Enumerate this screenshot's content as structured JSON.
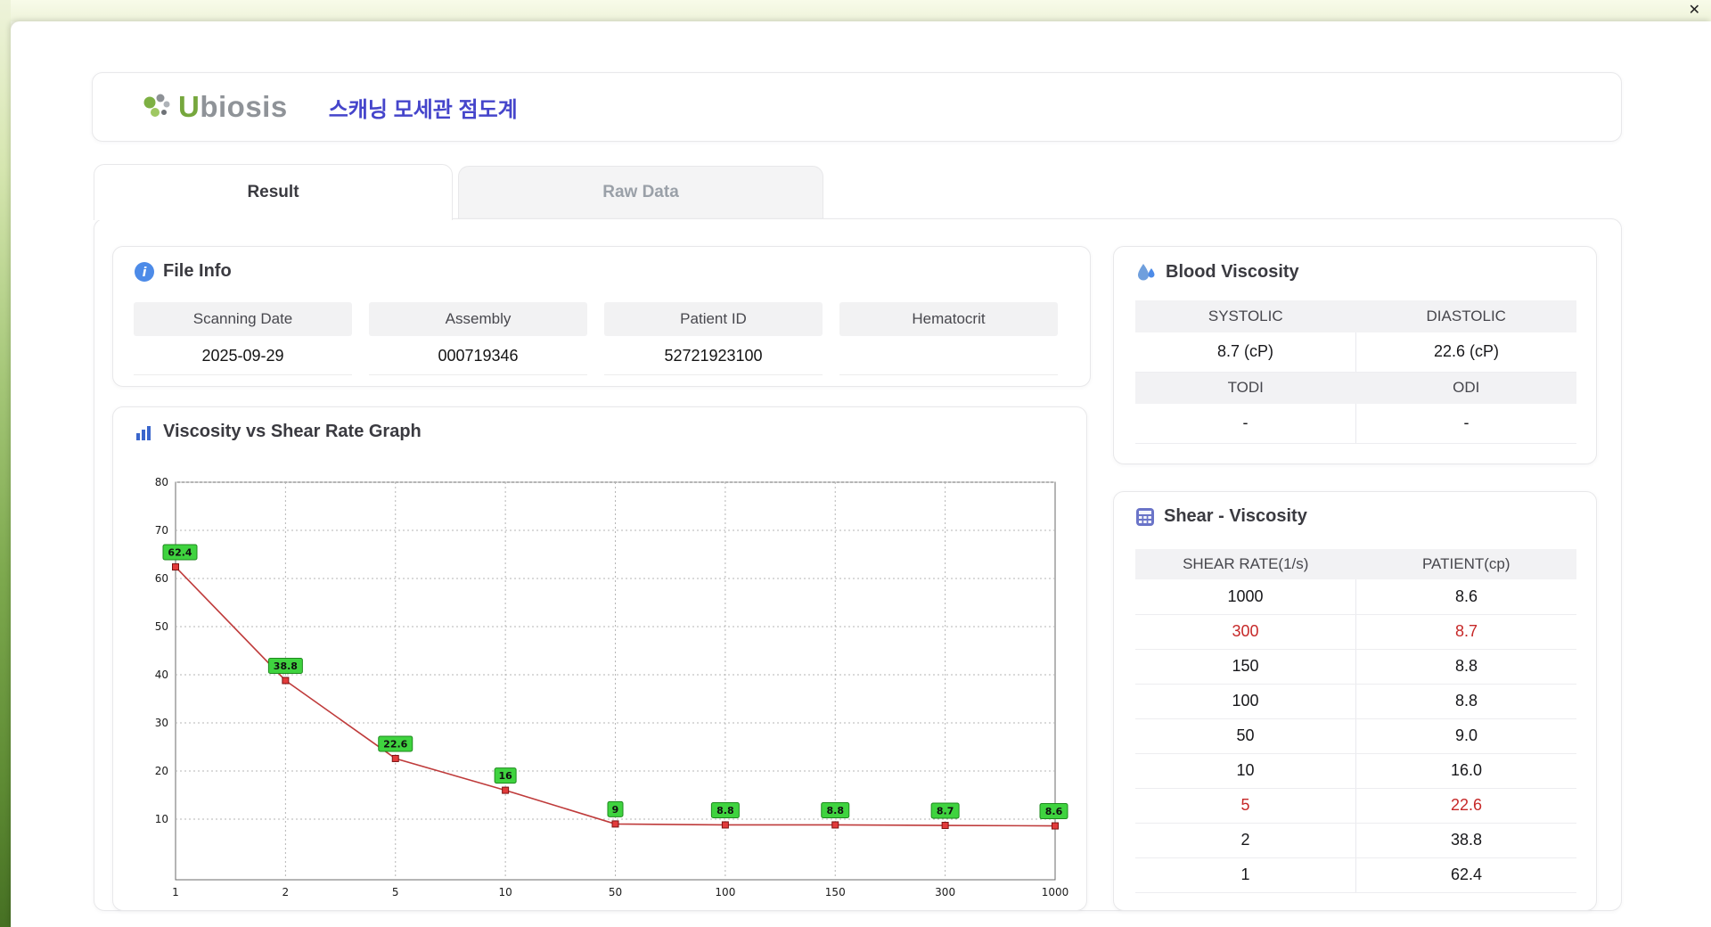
{
  "window": {
    "close_icon": "✕"
  },
  "header": {
    "logo_accent": "U",
    "logo_rest": "biosis",
    "app_title": "스캐닝 모세관 점도계"
  },
  "tabs": {
    "result": "Result",
    "raw_data": "Raw Data",
    "active": "Result"
  },
  "file_info": {
    "title": "File Info",
    "fields": [
      {
        "label": "Scanning Date",
        "value": "2025-09-29"
      },
      {
        "label": "Assembly",
        "value": "000719346"
      },
      {
        "label": "Patient ID",
        "value": "52721923100"
      },
      {
        "label": "Hematocrit",
        "value": ""
      }
    ]
  },
  "blood_viscosity": {
    "title": "Blood Viscosity",
    "systolic_label": "SYSTOLIC",
    "diastolic_label": "DIASTOLIC",
    "systolic_value": "8.7 (cP)",
    "diastolic_value": "22.6 (cP)",
    "todi_label": "TODI",
    "odi_label": "ODI",
    "todi_value": "-",
    "odi_value": "-"
  },
  "shear_viscosity": {
    "title": "Shear - Viscosity",
    "columns": [
      "SHEAR RATE(1/s)",
      "PATIENT(cp)"
    ],
    "rows": [
      {
        "shear": "1000",
        "patient": "8.6",
        "highlight": false
      },
      {
        "shear": "300",
        "patient": "8.7",
        "highlight": true
      },
      {
        "shear": "150",
        "patient": "8.8",
        "highlight": false
      },
      {
        "shear": "100",
        "patient": "8.8",
        "highlight": false
      },
      {
        "shear": "50",
        "patient": "9.0",
        "highlight": false
      },
      {
        "shear": "10",
        "patient": "16.0",
        "highlight": false
      },
      {
        "shear": "5",
        "patient": "22.6",
        "highlight": true
      },
      {
        "shear": "2",
        "patient": "38.8",
        "highlight": false
      },
      {
        "shear": "1",
        "patient": "62.4",
        "highlight": false
      }
    ]
  },
  "chart_data": {
    "type": "line",
    "title": "Viscosity vs Shear Rate Graph",
    "xlabel": "",
    "ylabel": "",
    "x": [
      1,
      2,
      5,
      10,
      50,
      100,
      150,
      300,
      1000
    ],
    "y": [
      62.4,
      38.8,
      22.6,
      16,
      9,
      8.8,
      8.8,
      8.7,
      8.6
    ],
    "point_labels": [
      "62.4",
      "38.8",
      "22.6",
      "16",
      "9",
      "8.8",
      "8.8",
      "8.7",
      "8.6"
    ],
    "ylim": [
      0,
      80
    ],
    "yticks": [
      10,
      20,
      30,
      40,
      50,
      60,
      70,
      80
    ],
    "x_scale": "categorical-even",
    "grid": "dotted",
    "legend": false,
    "line_color": "#bf3b3b",
    "marker_color": "#e23b3b",
    "marker_border": "#7c1212",
    "label_bg": "#3fd33f",
    "label_border": "#1d8a1d"
  },
  "colors": {
    "accent_blue": "#4545cb",
    "brand_green": "#76a73d",
    "brand_gray": "#8f9398",
    "highlight_red": "#c62828",
    "table_header_bg": "#f2f2f4"
  }
}
